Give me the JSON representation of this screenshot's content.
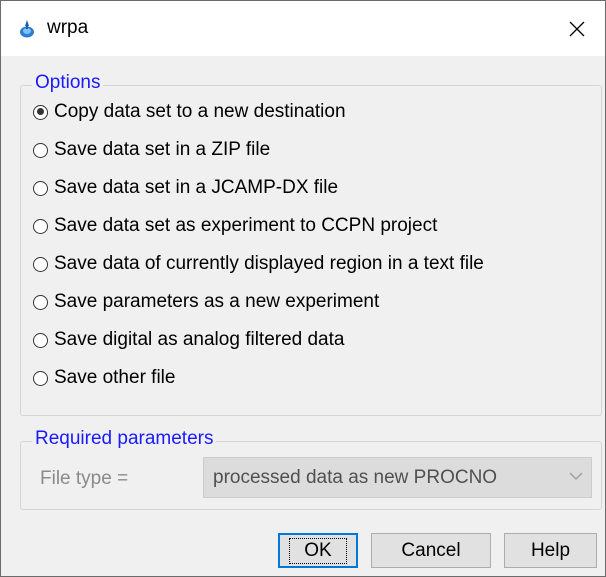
{
  "window": {
    "title": "wrpa",
    "icon": "bruker-topspin-icon",
    "close_symbol": "✕"
  },
  "options": {
    "legend": "Options",
    "selected_index": 0,
    "items": [
      {
        "label": "Copy data set to a new destination",
        "checked": true
      },
      {
        "label": "Save data set in a ZIP file",
        "checked": false
      },
      {
        "label": "Save data set in a JCAMP-DX file",
        "checked": false
      },
      {
        "label": "Save data set as experiment to CCPN project",
        "checked": false
      },
      {
        "label": "Save data of currently displayed region in a text file",
        "checked": false
      },
      {
        "label": "Save parameters as a new experiment",
        "checked": false
      },
      {
        "label": "Save digital as analog filtered data",
        "checked": false
      },
      {
        "label": "Save other file",
        "checked": false
      }
    ]
  },
  "required_parameters": {
    "legend": "Required parameters",
    "file_type_label": "File type =",
    "file_type_value": "processed data as new PROCNO",
    "enabled": false
  },
  "buttons": {
    "ok": "OK",
    "cancel": "Cancel",
    "help": "Help"
  },
  "colors": {
    "legend": "#1a1aff",
    "default_button_border": "#0078d7",
    "dialog_background": "#f0f0f0"
  }
}
